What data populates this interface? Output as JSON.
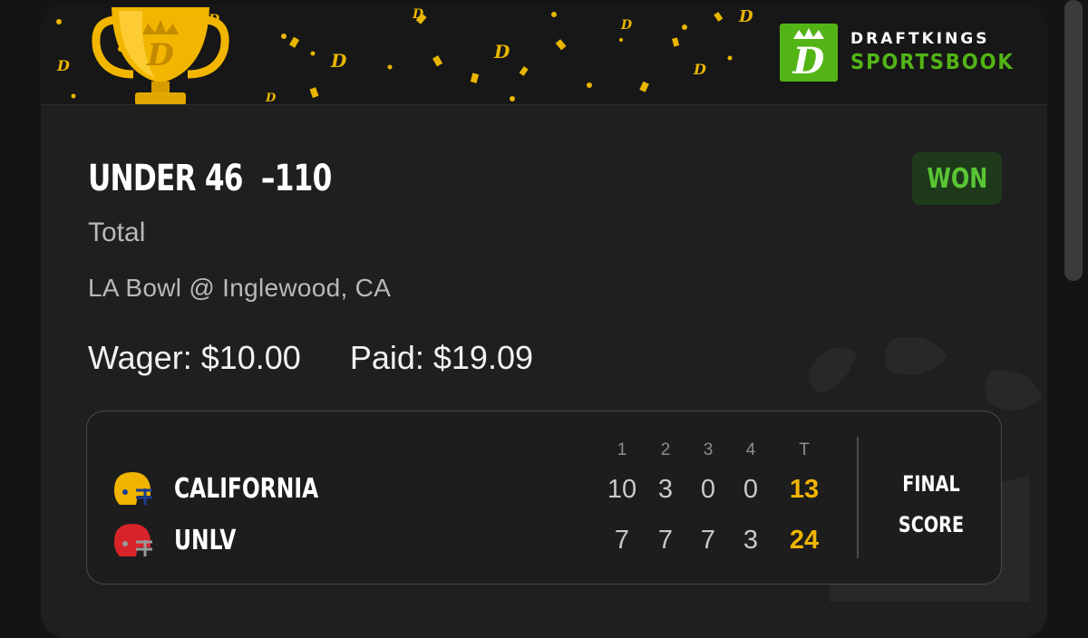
{
  "brand": {
    "line1": "DRAFTKINGS",
    "line2": "SPORTSBOOK",
    "accent_color": "#53b416",
    "banner_icons": [
      "trophy-icon",
      "crown-d-icon",
      "confetti"
    ]
  },
  "bet": {
    "selection": "UNDER 46  –110",
    "market": "Total",
    "event": "LA Bowl @ Inglewood, CA",
    "wager": "Wager: $10.00",
    "paid": "Paid: $19.09",
    "result": "WON",
    "result_color": "#59c534"
  },
  "scoreboard": {
    "period_headers": [
      "1",
      "2",
      "3",
      "4",
      "T"
    ],
    "teams": [
      {
        "name": "CALIFORNIA",
        "helmet_icon": "gold-helmet-icon",
        "helmet_color": "#f0b400",
        "scores": [
          "10",
          "3",
          "0",
          "0"
        ],
        "total": "13"
      },
      {
        "name": "UNLV",
        "helmet_icon": "red-helmet-icon",
        "helmet_color": "#d8232a",
        "scores": [
          "7",
          "7",
          "7",
          "3"
        ],
        "total": "24"
      }
    ],
    "status_line1": "FINAL",
    "status_line2": "SCORE",
    "total_color": "#f0b400"
  }
}
